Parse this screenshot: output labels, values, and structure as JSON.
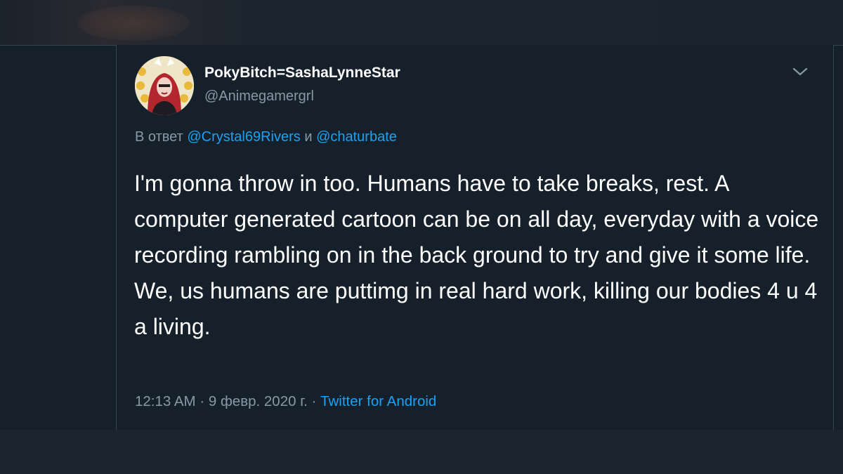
{
  "tweet": {
    "display_name": "PokyBitch=SashaLynneStar",
    "handle": "@Animegamergrl",
    "reply_prefix": "В ответ ",
    "reply_mention_1": "@Crystal69Rivers",
    "reply_conjunction": " и ",
    "reply_mention_2": "@chaturbate",
    "text": "I'm gonna throw in too. Humans have to take breaks, rest. A computer generated cartoon can be on all day, everyday with a voice recording rambling on in the back ground to try and give it some life. We, us humans are puttimg in real hard work, killing our bodies 4 u 4 a living.",
    "time": "12:13 AM",
    "separator": " · ",
    "date": "9 февр. 2020 г.",
    "separator_2": " · ",
    "source": "Twitter for Android"
  },
  "icons": {
    "menu": "chevron-down-icon",
    "avatar": "avatar"
  },
  "colors": {
    "background": "#15202b",
    "text_primary": "#ffffff",
    "text_secondary": "#8899a6",
    "accent": "#1da1f2",
    "border": "#38444d"
  }
}
